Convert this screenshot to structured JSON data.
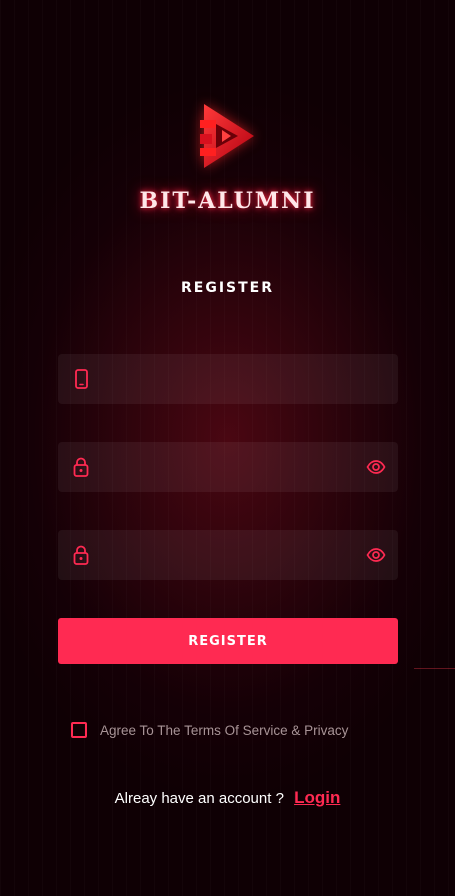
{
  "brand": {
    "name": "BIT-ALUMNI",
    "logo_icon": "play-triangle-logo"
  },
  "form": {
    "title": "REGISTER",
    "phone_field": {
      "icon": "phone-icon",
      "value": "",
      "placeholder": ""
    },
    "password_field": {
      "icon": "lock-icon",
      "trail_icon": "eye-icon",
      "value": "",
      "placeholder": ""
    },
    "confirm_password_field": {
      "icon": "lock-icon",
      "trail_icon": "eye-icon",
      "value": "",
      "placeholder": ""
    },
    "register_button": "REGISTER",
    "agree_label": "Agree To The Terms Of Service & Privacy",
    "agree_checked": false
  },
  "footer": {
    "prompt": "Alreay have an account ?",
    "login_link": "Login"
  },
  "colors": {
    "accent": "#ff2a52",
    "background": "#150006",
    "field_background": "rgba(255,255,255,0.06)"
  }
}
